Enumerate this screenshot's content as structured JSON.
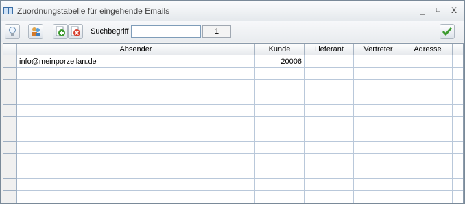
{
  "window": {
    "title": "Zuordnungstabelle für eingehende Emails",
    "min_symbol": "_",
    "max_symbol": "□",
    "close_symbol": "X"
  },
  "toolbar": {
    "search_label": "Suchbegriff",
    "search_value": "",
    "counter": "1",
    "icons": [
      "lightbulb-icon",
      "people-icon",
      "add-icon",
      "delete-icon",
      "checkmark-icon"
    ],
    "accent": "#3c9a2f"
  },
  "table": {
    "columns": [
      "",
      "Absender",
      "Kunde",
      "Lieferant",
      "Vertreter",
      "Adresse",
      ""
    ],
    "rows": [
      {
        "absender": "info@meinporzellan.de",
        "kunde": "20006",
        "lieferant": "",
        "vertreter": "",
        "adresse": ""
      },
      {
        "absender": "",
        "kunde": "",
        "lieferant": "",
        "vertreter": "",
        "adresse": ""
      },
      {
        "absender": "",
        "kunde": "",
        "lieferant": "",
        "vertreter": "",
        "adresse": ""
      },
      {
        "absender": "",
        "kunde": "",
        "lieferant": "",
        "vertreter": "",
        "adresse": ""
      },
      {
        "absender": "",
        "kunde": "",
        "lieferant": "",
        "vertreter": "",
        "adresse": ""
      },
      {
        "absender": "",
        "kunde": "",
        "lieferant": "",
        "vertreter": "",
        "adresse": ""
      },
      {
        "absender": "",
        "kunde": "",
        "lieferant": "",
        "vertreter": "",
        "adresse": ""
      },
      {
        "absender": "",
        "kunde": "",
        "lieferant": "",
        "vertreter": "",
        "adresse": ""
      },
      {
        "absender": "",
        "kunde": "",
        "lieferant": "",
        "vertreter": "",
        "adresse": ""
      },
      {
        "absender": "",
        "kunde": "",
        "lieferant": "",
        "vertreter": "",
        "adresse": ""
      },
      {
        "absender": "",
        "kunde": "",
        "lieferant": "",
        "vertreter": "",
        "adresse": ""
      },
      {
        "absender": "",
        "kunde": "",
        "lieferant": "",
        "vertreter": "",
        "adresse": ""
      }
    ]
  }
}
